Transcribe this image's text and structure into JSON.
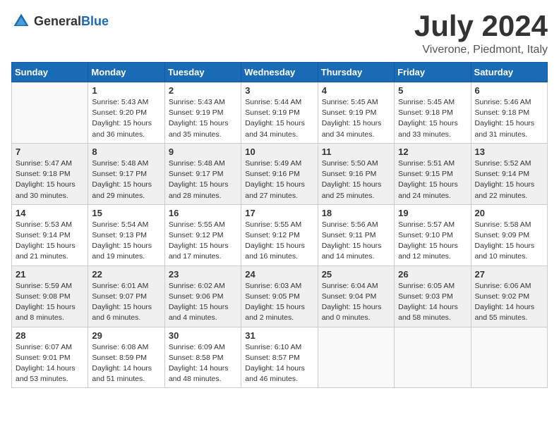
{
  "header": {
    "logo": {
      "text_general": "General",
      "text_blue": "Blue"
    },
    "title": "July 2024",
    "location": "Viverone, Piedmont, Italy"
  },
  "weekdays": [
    "Sunday",
    "Monday",
    "Tuesday",
    "Wednesday",
    "Thursday",
    "Friday",
    "Saturday"
  ],
  "weeks": [
    [
      {
        "day": "",
        "info": ""
      },
      {
        "day": "1",
        "info": "Sunrise: 5:43 AM\nSunset: 9:20 PM\nDaylight: 15 hours\nand 36 minutes."
      },
      {
        "day": "2",
        "info": "Sunrise: 5:43 AM\nSunset: 9:19 PM\nDaylight: 15 hours\nand 35 minutes."
      },
      {
        "day": "3",
        "info": "Sunrise: 5:44 AM\nSunset: 9:19 PM\nDaylight: 15 hours\nand 34 minutes."
      },
      {
        "day": "4",
        "info": "Sunrise: 5:45 AM\nSunset: 9:19 PM\nDaylight: 15 hours\nand 34 minutes."
      },
      {
        "day": "5",
        "info": "Sunrise: 5:45 AM\nSunset: 9:18 PM\nDaylight: 15 hours\nand 33 minutes."
      },
      {
        "day": "6",
        "info": "Sunrise: 5:46 AM\nSunset: 9:18 PM\nDaylight: 15 hours\nand 31 minutes."
      }
    ],
    [
      {
        "day": "7",
        "info": "Sunrise: 5:47 AM\nSunset: 9:18 PM\nDaylight: 15 hours\nand 30 minutes."
      },
      {
        "day": "8",
        "info": "Sunrise: 5:48 AM\nSunset: 9:17 PM\nDaylight: 15 hours\nand 29 minutes."
      },
      {
        "day": "9",
        "info": "Sunrise: 5:48 AM\nSunset: 9:17 PM\nDaylight: 15 hours\nand 28 minutes."
      },
      {
        "day": "10",
        "info": "Sunrise: 5:49 AM\nSunset: 9:16 PM\nDaylight: 15 hours\nand 27 minutes."
      },
      {
        "day": "11",
        "info": "Sunrise: 5:50 AM\nSunset: 9:16 PM\nDaylight: 15 hours\nand 25 minutes."
      },
      {
        "day": "12",
        "info": "Sunrise: 5:51 AM\nSunset: 9:15 PM\nDaylight: 15 hours\nand 24 minutes."
      },
      {
        "day": "13",
        "info": "Sunrise: 5:52 AM\nSunset: 9:14 PM\nDaylight: 15 hours\nand 22 minutes."
      }
    ],
    [
      {
        "day": "14",
        "info": "Sunrise: 5:53 AM\nSunset: 9:14 PM\nDaylight: 15 hours\nand 21 minutes."
      },
      {
        "day": "15",
        "info": "Sunrise: 5:54 AM\nSunset: 9:13 PM\nDaylight: 15 hours\nand 19 minutes."
      },
      {
        "day": "16",
        "info": "Sunrise: 5:55 AM\nSunset: 9:12 PM\nDaylight: 15 hours\nand 17 minutes."
      },
      {
        "day": "17",
        "info": "Sunrise: 5:55 AM\nSunset: 9:12 PM\nDaylight: 15 hours\nand 16 minutes."
      },
      {
        "day": "18",
        "info": "Sunrise: 5:56 AM\nSunset: 9:11 PM\nDaylight: 15 hours\nand 14 minutes."
      },
      {
        "day": "19",
        "info": "Sunrise: 5:57 AM\nSunset: 9:10 PM\nDaylight: 15 hours\nand 12 minutes."
      },
      {
        "day": "20",
        "info": "Sunrise: 5:58 AM\nSunset: 9:09 PM\nDaylight: 15 hours\nand 10 minutes."
      }
    ],
    [
      {
        "day": "21",
        "info": "Sunrise: 5:59 AM\nSunset: 9:08 PM\nDaylight: 15 hours\nand 8 minutes."
      },
      {
        "day": "22",
        "info": "Sunrise: 6:01 AM\nSunset: 9:07 PM\nDaylight: 15 hours\nand 6 minutes."
      },
      {
        "day": "23",
        "info": "Sunrise: 6:02 AM\nSunset: 9:06 PM\nDaylight: 15 hours\nand 4 minutes."
      },
      {
        "day": "24",
        "info": "Sunrise: 6:03 AM\nSunset: 9:05 PM\nDaylight: 15 hours\nand 2 minutes."
      },
      {
        "day": "25",
        "info": "Sunrise: 6:04 AM\nSunset: 9:04 PM\nDaylight: 15 hours\nand 0 minutes."
      },
      {
        "day": "26",
        "info": "Sunrise: 6:05 AM\nSunset: 9:03 PM\nDaylight: 14 hours\nand 58 minutes."
      },
      {
        "day": "27",
        "info": "Sunrise: 6:06 AM\nSunset: 9:02 PM\nDaylight: 14 hours\nand 55 minutes."
      }
    ],
    [
      {
        "day": "28",
        "info": "Sunrise: 6:07 AM\nSunset: 9:01 PM\nDaylight: 14 hours\nand 53 minutes."
      },
      {
        "day": "29",
        "info": "Sunrise: 6:08 AM\nSunset: 8:59 PM\nDaylight: 14 hours\nand 51 minutes."
      },
      {
        "day": "30",
        "info": "Sunrise: 6:09 AM\nSunset: 8:58 PM\nDaylight: 14 hours\nand 48 minutes."
      },
      {
        "day": "31",
        "info": "Sunrise: 6:10 AM\nSunset: 8:57 PM\nDaylight: 14 hours\nand 46 minutes."
      },
      {
        "day": "",
        "info": ""
      },
      {
        "day": "",
        "info": ""
      },
      {
        "day": "",
        "info": ""
      }
    ]
  ]
}
